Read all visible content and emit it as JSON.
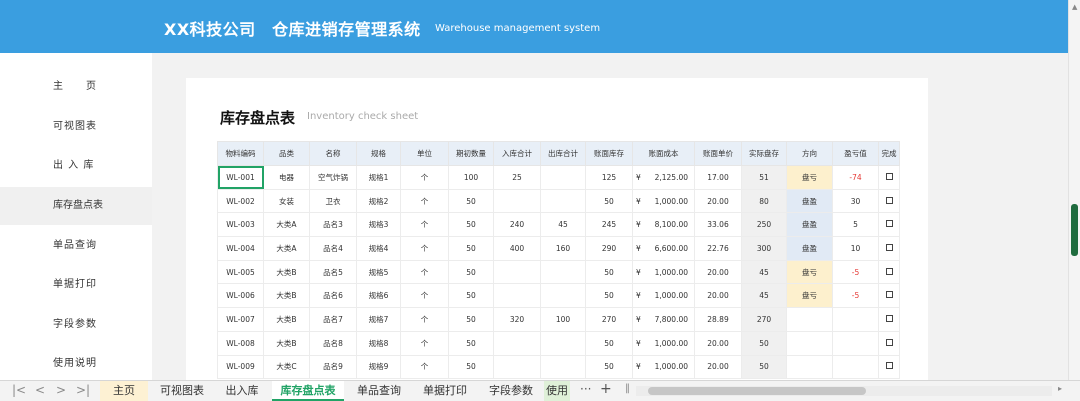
{
  "header": {
    "title": "XX科技公司　仓库进销存管理系统",
    "subtitle": "Warehouse management system"
  },
  "sidebar": {
    "items": [
      {
        "label": "主　　页"
      },
      {
        "label": "可视图表"
      },
      {
        "label": "出 入 库"
      },
      {
        "label": "库存盘点表"
      },
      {
        "label": "单品查询"
      },
      {
        "label": "单据打印"
      },
      {
        "label": "字段参数"
      },
      {
        "label": "使用说明"
      }
    ],
    "active_index": 3
  },
  "sheet": {
    "title": "库存盘点表",
    "subtitle": "Inventory check sheet",
    "columns": [
      "物料编码",
      "品类",
      "名称",
      "规格",
      "单位",
      "期初数量",
      "入库合计",
      "出库合计",
      "账面库存",
      "账面成本",
      "账面单价",
      "实际盘存",
      "方向",
      "盈亏值",
      "完成"
    ],
    "currency_symbol": "¥",
    "rows": [
      {
        "code": "WL-001",
        "category": "电器",
        "name": "空气炸锅",
        "spec": "规格1",
        "unit": "个",
        "opening": "100",
        "in_total": "25",
        "out_total": "",
        "book_stock": "125",
        "book_cost": "2,125.00",
        "unit_price": "17.00",
        "actual": "51",
        "direction": "盘亏",
        "diff": "-74",
        "done": ""
      },
      {
        "code": "WL-002",
        "category": "女装",
        "name": "卫衣",
        "spec": "规格2",
        "unit": "个",
        "opening": "50",
        "in_total": "",
        "out_total": "",
        "book_stock": "50",
        "book_cost": "1,000.00",
        "unit_price": "20.00",
        "actual": "80",
        "direction": "盘盈",
        "diff": "30",
        "done": ""
      },
      {
        "code": "WL-003",
        "category": "大类A",
        "name": "品名3",
        "spec": "规格3",
        "unit": "个",
        "opening": "50",
        "in_total": "240",
        "out_total": "45",
        "book_stock": "245",
        "book_cost": "8,100.00",
        "unit_price": "33.06",
        "actual": "250",
        "direction": "盘盈",
        "diff": "5",
        "done": ""
      },
      {
        "code": "WL-004",
        "category": "大类A",
        "name": "品名4",
        "spec": "规格4",
        "unit": "个",
        "opening": "50",
        "in_total": "400",
        "out_total": "160",
        "book_stock": "290",
        "book_cost": "6,600.00",
        "unit_price": "22.76",
        "actual": "300",
        "direction": "盘盈",
        "diff": "10",
        "done": ""
      },
      {
        "code": "WL-005",
        "category": "大类B",
        "name": "品名5",
        "spec": "规格5",
        "unit": "个",
        "opening": "50",
        "in_total": "",
        "out_total": "",
        "book_stock": "50",
        "book_cost": "1,000.00",
        "unit_price": "20.00",
        "actual": "45",
        "direction": "盘亏",
        "diff": "-5",
        "done": ""
      },
      {
        "code": "WL-006",
        "category": "大类B",
        "name": "品名6",
        "spec": "规格6",
        "unit": "个",
        "opening": "50",
        "in_total": "",
        "out_total": "",
        "book_stock": "50",
        "book_cost": "1,000.00",
        "unit_price": "20.00",
        "actual": "45",
        "direction": "盘亏",
        "diff": "-5",
        "done": ""
      },
      {
        "code": "WL-007",
        "category": "大类B",
        "name": "品名7",
        "spec": "规格7",
        "unit": "个",
        "opening": "50",
        "in_total": "320",
        "out_total": "100",
        "book_stock": "270",
        "book_cost": "7,800.00",
        "unit_price": "28.89",
        "actual": "270",
        "direction": "",
        "diff": "",
        "done": ""
      },
      {
        "code": "WL-008",
        "category": "大类B",
        "name": "品名8",
        "spec": "规格8",
        "unit": "个",
        "opening": "50",
        "in_total": "",
        "out_total": "",
        "book_stock": "50",
        "book_cost": "1,000.00",
        "unit_price": "20.00",
        "actual": "50",
        "direction": "",
        "diff": "",
        "done": ""
      },
      {
        "code": "WL-009",
        "category": "大类C",
        "name": "品名9",
        "spec": "规格9",
        "unit": "个",
        "opening": "50",
        "in_total": "",
        "out_total": "",
        "book_stock": "50",
        "book_cost": "1,000.00",
        "unit_price": "20.00",
        "actual": "50",
        "direction": "",
        "diff": "",
        "done": ""
      }
    ]
  },
  "tabbar": {
    "tabs": [
      "主页",
      "可视图表",
      "出入库",
      "库存盘点表",
      "单品查询",
      "单据打印",
      "字段参数",
      "使用说"
    ],
    "active_index": 3,
    "more_label": "···",
    "add_label": "+"
  },
  "colors": {
    "header_bg": "#3a9ee0",
    "table_header_bg": "#e8eff7",
    "loss_bg": "#fdf0cd",
    "gain_bg": "#e1eaf5",
    "negative_text": "#e53935",
    "active_tab": "#21a366"
  }
}
